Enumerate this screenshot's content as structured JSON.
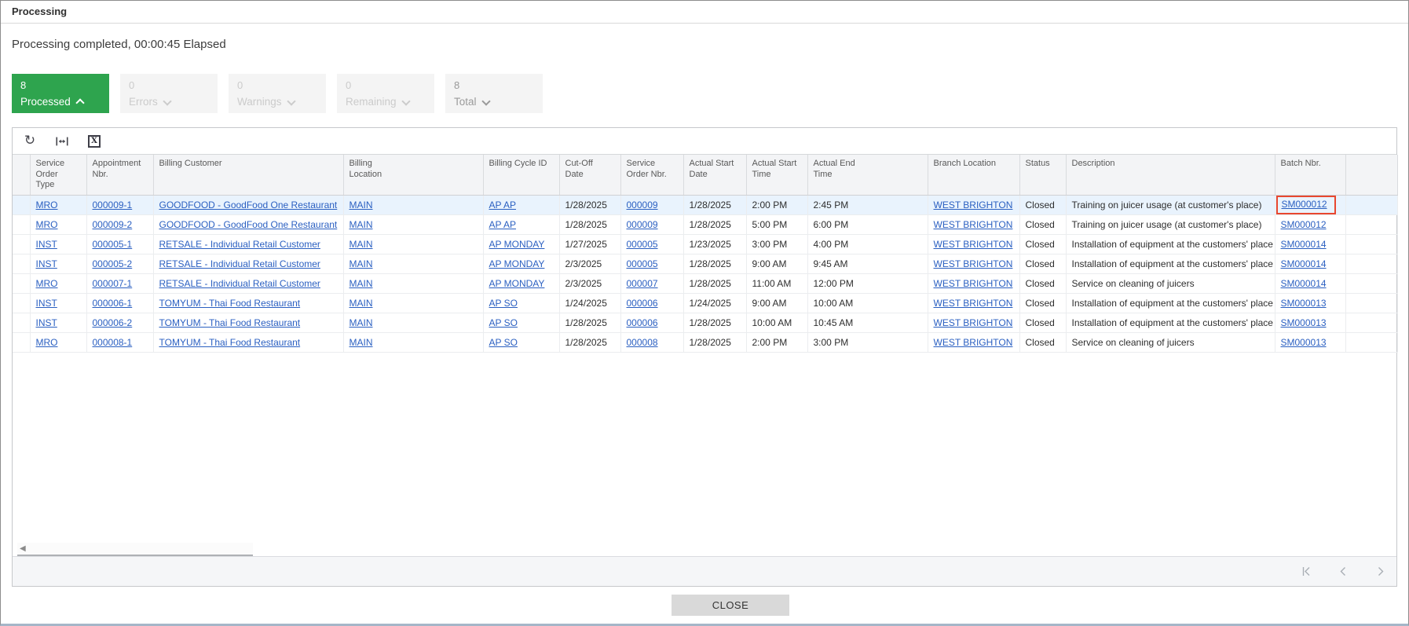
{
  "dialog": {
    "title": "Processing",
    "status_message": "Processing completed, 00:00:45 Elapsed",
    "close_label": "CLOSE"
  },
  "summary_badges": [
    {
      "id": "processed",
      "count": "8",
      "label": "Processed",
      "chevron": "up",
      "state": "active"
    },
    {
      "id": "errors",
      "count": "0",
      "label": "Errors",
      "chevron": "down",
      "state": "disabled"
    },
    {
      "id": "warnings",
      "count": "0",
      "label": "Warnings",
      "chevron": "down",
      "state": "disabled"
    },
    {
      "id": "remaining",
      "count": "0",
      "label": "Remaining",
      "chevron": "down",
      "state": "disabled"
    },
    {
      "id": "total",
      "count": "8",
      "label": "Total",
      "chevron": "down",
      "state": "muted"
    }
  ],
  "toolbar": {
    "icons": [
      "refresh-icon",
      "fit-width-icon",
      "export-excel-icon"
    ]
  },
  "grid": {
    "columns": [
      {
        "key": "selector",
        "label": "",
        "link": false
      },
      {
        "key": "type",
        "label": "Service Order Type",
        "link": true
      },
      {
        "key": "appt",
        "label": "Appointment Nbr.",
        "link": true
      },
      {
        "key": "customer",
        "label": "Billing Customer",
        "link": true
      },
      {
        "key": "billing_location",
        "label": "Billing Location",
        "link": true
      },
      {
        "key": "cycle",
        "label": "Billing Cycle ID",
        "link": true
      },
      {
        "key": "cutoff",
        "label": "Cut-Off Date",
        "link": false
      },
      {
        "key": "so_nbr",
        "label": "Service Order Nbr.",
        "link": true
      },
      {
        "key": "start_date",
        "label": "Actual Start Date",
        "link": false
      },
      {
        "key": "start_time",
        "label": "Actual Start Time",
        "link": false
      },
      {
        "key": "end_time",
        "label": "Actual End Time",
        "link": false
      },
      {
        "key": "branch",
        "label": "Branch Location",
        "link": true
      },
      {
        "key": "status",
        "label": "Status",
        "link": false
      },
      {
        "key": "desc",
        "label": "Description",
        "link": false
      },
      {
        "key": "batch",
        "label": "Batch Nbr.",
        "link": true
      },
      {
        "key": "filler",
        "label": "",
        "link": false
      }
    ],
    "rows": [
      {
        "type": "MRO",
        "appt": "000009-1",
        "customer": "GOODFOOD - GoodFood One Restaurant",
        "billing_location": "MAIN",
        "cycle": "AP AP",
        "cutoff": "1/28/2025",
        "so_nbr": "000009",
        "start_date": "1/28/2025",
        "start_time": "2:00 PM",
        "end_time": "2:45 PM",
        "branch": "WEST BRIGHTON",
        "status": "Closed",
        "desc": "Training on juicer usage (at customer's place)",
        "batch": "SM000012"
      },
      {
        "type": "MRO",
        "appt": "000009-2",
        "customer": "GOODFOOD - GoodFood One Restaurant",
        "billing_location": "MAIN",
        "cycle": "AP AP",
        "cutoff": "1/28/2025",
        "so_nbr": "000009",
        "start_date": "1/28/2025",
        "start_time": "5:00 PM",
        "end_time": "6:00 PM",
        "branch": "WEST BRIGHTON",
        "status": "Closed",
        "desc": "Training on juicer usage (at customer's place)",
        "batch": "SM000012"
      },
      {
        "type": "INST",
        "appt": "000005-1",
        "customer": "RETSALE - Individual Retail Customer",
        "billing_location": "MAIN",
        "cycle": "AP MONDAY",
        "cutoff": "1/27/2025",
        "so_nbr": "000005",
        "start_date": "1/23/2025",
        "start_time": "3:00 PM",
        "end_time": "4:00 PM",
        "branch": "WEST BRIGHTON",
        "status": "Closed",
        "desc": "Installation of equipment at the customers' place",
        "batch": "SM000014"
      },
      {
        "type": "INST",
        "appt": "000005-2",
        "customer": "RETSALE - Individual Retail Customer",
        "billing_location": "MAIN",
        "cycle": "AP MONDAY",
        "cutoff": "2/3/2025",
        "so_nbr": "000005",
        "start_date": "1/28/2025",
        "start_time": "9:00 AM",
        "end_time": "9:45 AM",
        "branch": "WEST BRIGHTON",
        "status": "Closed",
        "desc": "Installation of equipment at the customers' place",
        "batch": "SM000014"
      },
      {
        "type": "MRO",
        "appt": "000007-1",
        "customer": "RETSALE - Individual Retail Customer",
        "billing_location": "MAIN",
        "cycle": "AP MONDAY",
        "cutoff": "2/3/2025",
        "so_nbr": "000007",
        "start_date": "1/28/2025",
        "start_time": "11:00 AM",
        "end_time": "12:00 PM",
        "branch": "WEST BRIGHTON",
        "status": "Closed",
        "desc": "Service on cleaning of juicers",
        "batch": "SM000014"
      },
      {
        "type": "INST",
        "appt": "000006-1",
        "customer": "TOMYUM - Thai Food Restaurant",
        "billing_location": "MAIN",
        "cycle": "AP SO",
        "cutoff": "1/24/2025",
        "so_nbr": "000006",
        "start_date": "1/24/2025",
        "start_time": "9:00 AM",
        "end_time": "10:00 AM",
        "branch": "WEST BRIGHTON",
        "status": "Closed",
        "desc": "Installation of equipment at the customers' place",
        "batch": "SM000013"
      },
      {
        "type": "INST",
        "appt": "000006-2",
        "customer": "TOMYUM - Thai Food Restaurant",
        "billing_location": "MAIN",
        "cycle": "AP SO",
        "cutoff": "1/28/2025",
        "so_nbr": "000006",
        "start_date": "1/28/2025",
        "start_time": "10:00 AM",
        "end_time": "10:45 AM",
        "branch": "WEST BRIGHTON",
        "status": "Closed",
        "desc": "Installation of equipment at the customers' place",
        "batch": "SM000013"
      },
      {
        "type": "MRO",
        "appt": "000008-1",
        "customer": "TOMYUM - Thai Food Restaurant",
        "billing_location": "MAIN",
        "cycle": "AP SO",
        "cutoff": "1/28/2025",
        "so_nbr": "000008",
        "start_date": "1/28/2025",
        "start_time": "2:00 PM",
        "end_time": "3:00 PM",
        "branch": "WEST BRIGHTON",
        "status": "Closed",
        "desc": "Service on cleaning of juicers",
        "batch": "SM000013"
      }
    ],
    "selected_row_index": 0,
    "highlight": {
      "row_index": 0,
      "column": "batch",
      "border_color": "#e8472f"
    }
  },
  "pagination": {
    "icons": [
      "first-page-icon",
      "previous-page-icon",
      "next-page-icon"
    ]
  },
  "colors": {
    "processed_badge_green": "#2ea44e",
    "link_blue": "#2a5fc1",
    "selected_row_blue": "#e9f3fd",
    "highlight_border_red": "#e8472f"
  }
}
